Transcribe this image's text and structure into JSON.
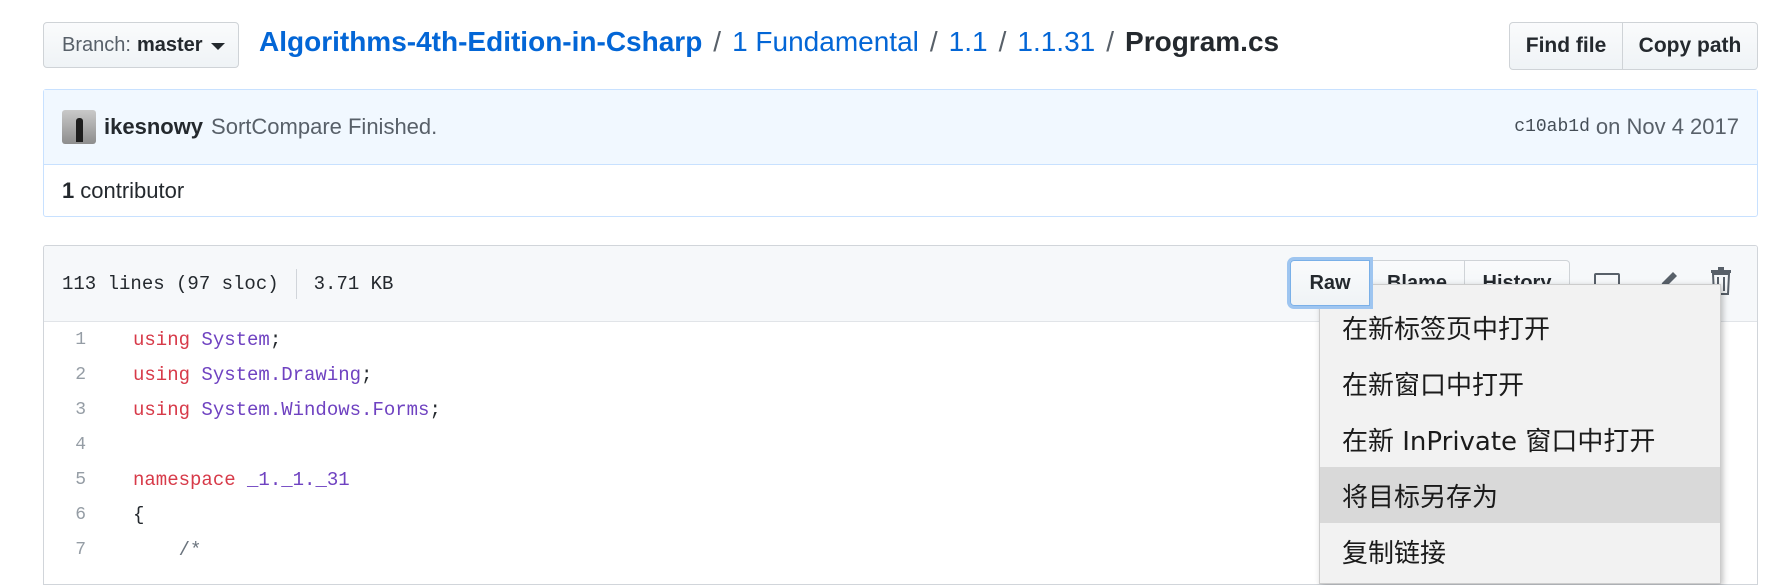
{
  "branch": {
    "label": "Branch:",
    "value": "master"
  },
  "breadcrumb": {
    "repo": "Algorithms-4th-Edition-in-Csharp",
    "items": [
      "1 Fundamental",
      "1.1",
      "1.1.31"
    ],
    "current": "Program.cs",
    "separator": "/"
  },
  "actions": {
    "find_file": "Find file",
    "copy_path": "Copy path"
  },
  "commit": {
    "author": "ikesnowy",
    "message": "SortCompare Finished.",
    "sha": "c10ab1d",
    "date": "on Nov 4 2017"
  },
  "contributors": {
    "count": "1",
    "label": "contributor"
  },
  "file": {
    "lines": "113 lines (97 sloc)",
    "size": "3.71 KB",
    "buttons": {
      "raw": "Raw",
      "blame": "Blame",
      "history": "History"
    }
  },
  "code": {
    "line_numbers": [
      "1",
      "2",
      "3",
      "4",
      "5",
      "6",
      "7"
    ],
    "lines": [
      {
        "kw": "using",
        "rest": " System",
        "punct": ";"
      },
      {
        "kw": "using",
        "rest": " System.Drawing",
        "punct": ";"
      },
      {
        "kw": "using",
        "rest": " System.Windows.Forms",
        "punct": ";"
      },
      {
        "kw": "",
        "rest": "",
        "punct": ""
      },
      {
        "kw": "namespace",
        "rest": " _1._1._31",
        "punct": ""
      },
      {
        "kw": "",
        "rest": "",
        "punct": "{"
      },
      {
        "kw": "",
        "rest": "",
        "punct": "    /*"
      }
    ]
  },
  "context_menu": {
    "items": [
      "在新标签页中打开",
      "在新窗口中打开",
      "在新 InPrivate 窗口中打开",
      "将目标另存为",
      "复制链接"
    ],
    "highlighted": "将目标另存为"
  },
  "colors": {
    "link": "#0366d6",
    "keyword": "#d73a49",
    "type": "#6f42c1",
    "commit_bg": "#f1f8ff"
  }
}
